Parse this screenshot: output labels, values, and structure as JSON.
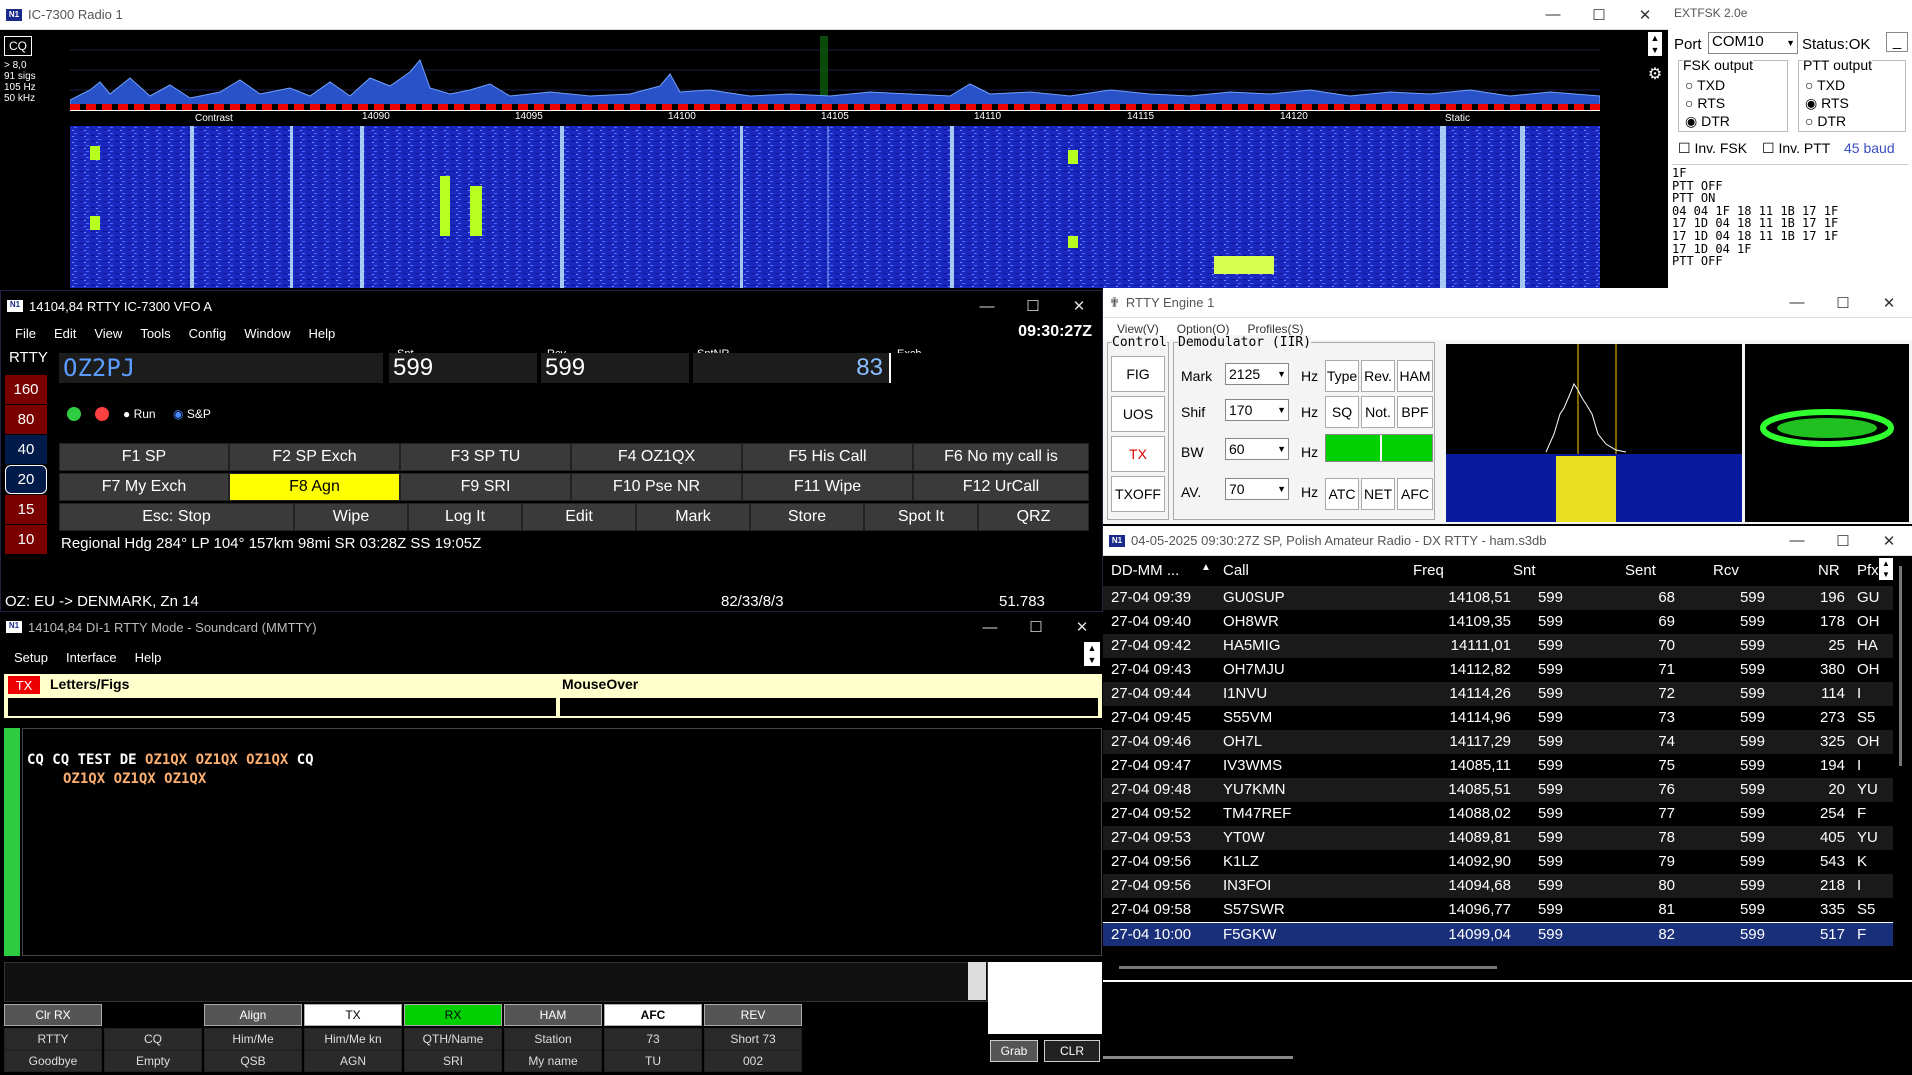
{
  "pan": {
    "title": "IC-7300 Radio 1",
    "cq": "CQ",
    "info": [
      "> 8,0",
      "91 sigs",
      "105 Hz",
      "50 kHz"
    ],
    "freqs": [
      "14090",
      "14095",
      "14100",
      "14105",
      "14110",
      "14115",
      "14120"
    ],
    "contrast": "Contrast",
    "static": "Static"
  },
  "ext": {
    "title": "EXTFSK 2.0e",
    "port_label": "Port",
    "port": "COM10",
    "status": "Status:OK",
    "fsk_out": "FSK output",
    "ptt_out": "PTT output",
    "txd": "TXD",
    "rts": "RTS",
    "dtr": "DTR",
    "inv_fsk": "Inv. FSK",
    "inv_ptt": "Inv. PTT",
    "baud": "45 baud",
    "log": [
      "1F",
      "PTT OFF",
      "PTT ON",
      "04 04 1F 18 11 1B 17 1F",
      "17 1D 04 18 11 1B 17 1F",
      "17 1D 04 18 11 1B 17 1F",
      "17 1D 04 1F",
      "PTT OFF"
    ]
  },
  "log": {
    "title": "14104,84 RTTY IC-7300 VFO A",
    "menu": [
      "File",
      "Edit",
      "View",
      "Tools",
      "Config",
      "Window",
      "Help"
    ],
    "time": "09:30:27Z",
    "mode": "RTTY",
    "bands": [
      "160",
      "80",
      "40",
      "20",
      "15",
      "10"
    ],
    "call": "OZ2PJ",
    "snt_label": "Snt",
    "snt": "599",
    "rcv_label": "Rcv",
    "rcv": "599",
    "sntnr_label": "SntNR",
    "sntnr": "83",
    "exch_label": "Exch",
    "run": "Run",
    "sp": "S&P",
    "fkeys1": [
      "F1 SP",
      "F2 SP Exch",
      "F3 SP TU",
      "F4 OZ1QX",
      "F5 His Call",
      "F6 No my call is"
    ],
    "fkeys2": [
      "F7 My Exch",
      "F8 Agn",
      "F9 SRI",
      "F10  Pse NR",
      "F11 Wipe",
      "F12 UrCall"
    ],
    "fkeys3": [
      "Esc: Stop",
      "Wipe",
      "Log It",
      "Edit",
      "Mark",
      "Store",
      "Spot It",
      "QRZ"
    ],
    "info": "Regional Hdg 284° LP 104° 157km 98mi SR 03:28Z SS 19:05Z",
    "status_left": "OZ: EU -> DENMARK, Zn 14",
    "status_mid": "82/33/8/3",
    "status_right": "51.783"
  },
  "mm": {
    "title": "14104,84 DI-1 RTTY Mode - Soundcard (MMTTY)",
    "menu": [
      "Setup",
      "Interface",
      "Help"
    ],
    "tx": "TX",
    "lf": "Letters/Figs",
    "mouse": "MouseOver",
    "line1a": "CQ CQ TEST DE ",
    "line1b": "OZ1QX OZ1QX OZ1QX",
    "line1c": " CQ",
    "line2": "OZ1QX OZ1QX OZ1QX",
    "btn1": [
      "Clr RX",
      "",
      "Align",
      "TX",
      "RX",
      "HAM",
      "AFC",
      "REV"
    ],
    "btn2": [
      "RTTY",
      "CQ",
      "Him/Me",
      "Him/Me kn",
      "QTH/Name",
      "Station",
      "73",
      "Short 73"
    ],
    "btn3": [
      "Goodbye",
      "Empty",
      "QSB",
      "AGN",
      "SRI",
      "My name",
      "TU",
      "002"
    ],
    "grab": "Grab",
    "clr": "CLR"
  },
  "eng": {
    "title": "RTTY Engine 1",
    "menu": [
      "View(V)",
      "Option(O)",
      "Profiles(S)"
    ],
    "control": "Control",
    "demod": "Demodulator (IIR)",
    "fig": "FIG",
    "uos": "UOS",
    "tx": "TX",
    "txoff": "TXOFF",
    "mark_l": "Mark",
    "mark": "2125",
    "shif_l": "Shif",
    "shif": "170",
    "bw_l": "BW",
    "bw": "60",
    "av_l": "AV.",
    "av": "70",
    "hz": "Hz",
    "type": "Type",
    "rev": "Rev.",
    "ham": "HAM",
    "sq": "SQ",
    "not": "Not.",
    "bpf": "BPF",
    "atc": "ATC",
    "net": "NET",
    "afc": "AFC"
  },
  "dx": {
    "title": "04-05-2025 09:30:27Z  SP, Polish Amateur Radio - DX RTTY - ham.s3db",
    "headers": [
      "DD-MM ...",
      "Call",
      "Freq",
      "Snt",
      "Sent",
      "Rcv",
      "NR",
      "Pfx"
    ],
    "rows": [
      [
        "27-04 09:39",
        "GU0SUP",
        "14108,51",
        "599",
        "68",
        "599",
        "196",
        "GU"
      ],
      [
        "27-04 09:40",
        "OH8WR",
        "14109,35",
        "599",
        "69",
        "599",
        "178",
        "OH"
      ],
      [
        "27-04 09:42",
        "HA5MIG",
        "14111,01",
        "599",
        "70",
        "599",
        "25",
        "HA"
      ],
      [
        "27-04 09:43",
        "OH7MJU",
        "14112,82",
        "599",
        "71",
        "599",
        "380",
        "OH"
      ],
      [
        "27-04 09:44",
        "I1NVU",
        "14114,26",
        "599",
        "72",
        "599",
        "114",
        "I"
      ],
      [
        "27-04 09:45",
        "S55VM",
        "14114,96",
        "599",
        "73",
        "599",
        "273",
        "S5"
      ],
      [
        "27-04 09:46",
        "OH7L",
        "14117,29",
        "599",
        "74",
        "599",
        "325",
        "OH"
      ],
      [
        "27-04 09:47",
        "IV3WMS",
        "14085,11",
        "599",
        "75",
        "599",
        "194",
        "I"
      ],
      [
        "27-04 09:48",
        "YU7KMN",
        "14085,51",
        "599",
        "76",
        "599",
        "20",
        "YU"
      ],
      [
        "27-04 09:52",
        "TM47REF",
        "14088,02",
        "599",
        "77",
        "599",
        "254",
        "F"
      ],
      [
        "27-04 09:53",
        "YT0W",
        "14089,81",
        "599",
        "78",
        "599",
        "405",
        "YU"
      ],
      [
        "27-04 09:56",
        "K1LZ",
        "14092,90",
        "599",
        "79",
        "599",
        "543",
        "K"
      ],
      [
        "27-04 09:56",
        "IN3FOI",
        "14094,68",
        "599",
        "80",
        "599",
        "218",
        "I"
      ],
      [
        "27-04 09:58",
        "S57SWR",
        "14096,77",
        "599",
        "81",
        "599",
        "335",
        "S5"
      ],
      [
        "27-04 10:00",
        "F5GKW",
        "14099,04",
        "599",
        "82",
        "599",
        "517",
        "F"
      ]
    ]
  }
}
